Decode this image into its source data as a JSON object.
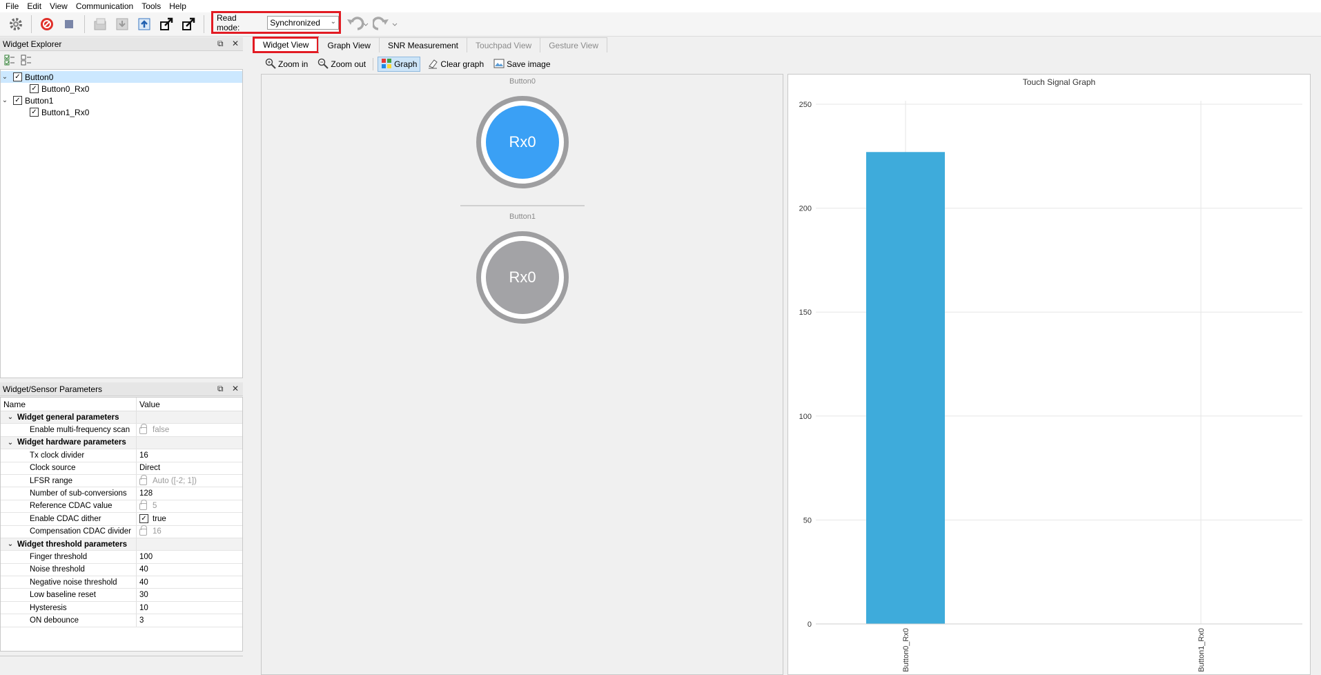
{
  "menu": [
    "File",
    "Edit",
    "View",
    "Communication",
    "Tools",
    "Help"
  ],
  "toolbar": {
    "read_mode_label": "Read mode:",
    "read_mode_value": "Synchronized",
    "icons": [
      "gear-icon",
      "stop-scan-icon",
      "stop-icon",
      "open-icon",
      "save-down-icon",
      "upload-icon",
      "export-icon",
      "export-alt-icon",
      "log-icon",
      "undo-icon",
      "redo-icon"
    ]
  },
  "widget_explorer": {
    "title": "Widget Explorer",
    "items": [
      {
        "label": "Button0",
        "level": 0,
        "checked": true,
        "expanded": true,
        "selected": true
      },
      {
        "label": "Button0_Rx0",
        "level": 1,
        "checked": true
      },
      {
        "label": "Button1",
        "level": 0,
        "checked": true,
        "expanded": true,
        "selected": false
      },
      {
        "label": "Button1_Rx0",
        "level": 1,
        "checked": true
      }
    ]
  },
  "params": {
    "title": "Widget/Sensor Parameters",
    "col_name": "Name",
    "col_value": "Value",
    "rows": [
      {
        "group": true,
        "name": "Widget general parameters",
        "value": ""
      },
      {
        "name": "Enable multi-frequency scan",
        "value": "false",
        "locked": true
      },
      {
        "group": true,
        "name": "Widget hardware parameters",
        "value": ""
      },
      {
        "name": "Tx clock divider",
        "value": "16"
      },
      {
        "name": "Clock source",
        "value": "Direct"
      },
      {
        "name": "LFSR range",
        "value": "Auto ([-2; 1])",
        "locked": true
      },
      {
        "name": "Number of sub-conversions",
        "value": "128"
      },
      {
        "name": "Reference CDAC value",
        "value": "5",
        "locked": true
      },
      {
        "name": "Enable CDAC dither",
        "value": "true",
        "checkbox": true
      },
      {
        "name": "Compensation CDAC divider",
        "value": "16",
        "locked": true
      },
      {
        "group": true,
        "name": "Widget threshold parameters",
        "value": ""
      },
      {
        "name": "Finger threshold",
        "value": "100"
      },
      {
        "name": "Noise threshold",
        "value": "40"
      },
      {
        "name": "Negative noise threshold",
        "value": "40"
      },
      {
        "name": "Low baseline reset",
        "value": "30"
      },
      {
        "name": "Hysteresis",
        "value": "10"
      },
      {
        "name": "ON debounce",
        "value": "3"
      }
    ]
  },
  "tabs": [
    {
      "label": "Widget View",
      "active": true
    },
    {
      "label": "Graph View"
    },
    {
      "label": "SNR Measurement"
    },
    {
      "label": "Touchpad View",
      "disabled": true
    },
    {
      "label": "Gesture View",
      "disabled": true
    }
  ],
  "viewbar": {
    "zoom_in": "Zoom in",
    "zoom_out": "Zoom out",
    "graph": "Graph",
    "clear_graph": "Clear graph",
    "save_image": "Save image"
  },
  "widgets": [
    {
      "title": "Button0",
      "sensor": "Rx0",
      "active": true,
      "color": "#3aa0f5"
    },
    {
      "title": "Button1",
      "sensor": "Rx0",
      "active": false,
      "color": "#a3a3a6"
    }
  ],
  "chart_data": {
    "type": "bar",
    "title": "Touch Signal Graph",
    "categories": [
      "Button0_Rx0",
      "Button1_Rx0"
    ],
    "values": [
      227,
      0
    ],
    "ylim": [
      0,
      250
    ],
    "yticks": [
      0,
      50,
      100,
      150,
      200,
      250
    ],
    "bar_color": "#3eabdb",
    "grid": true
  }
}
